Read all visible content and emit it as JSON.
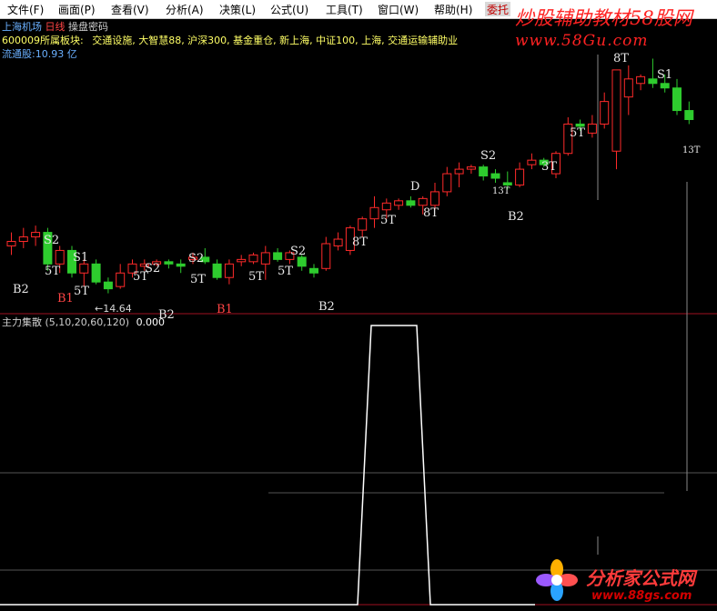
{
  "menu": [
    "文件(F)",
    "画面(P)",
    "查看(V)",
    "分析(A)",
    "决策(L)",
    "公式(U)",
    "工具(T)",
    "窗口(W)",
    "帮助(H)"
  ],
  "menu_trade": "委托",
  "watermark": {
    "top": "炒股辅助教材58股网",
    "url": "www.58Gu.com"
  },
  "header": {
    "stock_name": "上海机场",
    "period": "日线",
    "extra": "操盘密码",
    "sector_code_label": "600009所属板块:",
    "sectors": "交通设施, 大智慧88, 沪深300, 基金重仓, 新上海, 中证100, 上海, 交通运输辅助业",
    "float_shares": "流通股:10.93 亿"
  },
  "indicator": {
    "name": "主力集散",
    "params": "(5,10,20,60,120)",
    "value": "0.000"
  },
  "price_annotation": "←14.64",
  "signals": [
    {
      "text": "S2",
      "cls": "w"
    },
    {
      "text": "S1",
      "cls": "w"
    },
    {
      "text": "B2",
      "cls": "w"
    },
    {
      "text": "B1",
      "cls": "r"
    },
    {
      "text": "5T",
      "cls": "w"
    },
    {
      "text": "5T",
      "cls": "w"
    },
    {
      "text": "S2",
      "cls": "w"
    },
    {
      "text": "5T",
      "cls": "w"
    },
    {
      "text": "B2",
      "cls": "w"
    },
    {
      "text": "S2",
      "cls": "w"
    },
    {
      "text": "5T",
      "cls": "w"
    },
    {
      "text": "B1",
      "cls": "r"
    },
    {
      "text": "5T",
      "cls": "w"
    },
    {
      "text": "S2",
      "cls": "w"
    },
    {
      "text": "5T",
      "cls": "w"
    },
    {
      "text": "B2",
      "cls": "w"
    },
    {
      "text": "8T",
      "cls": "w"
    },
    {
      "text": "5T",
      "cls": "w"
    },
    {
      "text": "D",
      "cls": "w"
    },
    {
      "text": "8T",
      "cls": "w"
    },
    {
      "text": "S2",
      "cls": "w"
    },
    {
      "text": "13T",
      "cls": "w"
    },
    {
      "text": "B2",
      "cls": "w"
    },
    {
      "text": "3T",
      "cls": "w"
    },
    {
      "text": "5T",
      "cls": "w"
    },
    {
      "text": "8T",
      "cls": "w"
    },
    {
      "text": "S1",
      "cls": "w"
    },
    {
      "text": "13T",
      "cls": "w"
    }
  ],
  "logo": {
    "name": "分析家公式网",
    "url": "www.88gs.com"
  },
  "colors": {
    "up": "#ff2a2a",
    "down": "#2ecc2e",
    "divider": "#a01020",
    "text_yellow": "#ffff66",
    "text_blue": "#6ab0ff"
  },
  "chart_data": {
    "type": "candlestick",
    "series": [
      {
        "o": 13.9,
        "h": 14.2,
        "l": 13.7,
        "c": 14.0
      },
      {
        "o": 14.0,
        "h": 14.3,
        "l": 13.85,
        "c": 14.1
      },
      {
        "o": 14.1,
        "h": 14.35,
        "l": 13.9,
        "c": 14.2
      },
      {
        "o": 14.2,
        "h": 14.3,
        "l": 13.35,
        "c": 13.5
      },
      {
        "o": 13.5,
        "h": 13.9,
        "l": 13.3,
        "c": 13.8
      },
      {
        "o": 13.8,
        "h": 13.9,
        "l": 13.2,
        "c": 13.3
      },
      {
        "o": 13.3,
        "h": 13.6,
        "l": 13.0,
        "c": 13.5
      },
      {
        "o": 13.5,
        "h": 13.6,
        "l": 13.05,
        "c": 13.1
      },
      {
        "o": 13.1,
        "h": 13.2,
        "l": 12.85,
        "c": 12.95
      },
      {
        "o": 13.0,
        "h": 13.5,
        "l": 12.95,
        "c": 13.3
      },
      {
        "o": 13.3,
        "h": 13.6,
        "l": 13.2,
        "c": 13.5
      },
      {
        "o": 13.45,
        "h": 13.6,
        "l": 13.35,
        "c": 13.5
      },
      {
        "o": 13.5,
        "h": 13.6,
        "l": 13.45,
        "c": 13.55
      },
      {
        "o": 13.55,
        "h": 13.6,
        "l": 13.4,
        "c": 13.5
      },
      {
        "o": 13.5,
        "h": 13.6,
        "l": 13.3,
        "c": 13.45
      },
      {
        "o": 13.6,
        "h": 13.75,
        "l": 13.5,
        "c": 13.65
      },
      {
        "o": 13.65,
        "h": 13.85,
        "l": 13.5,
        "c": 13.55
      },
      {
        "o": 13.5,
        "h": 13.6,
        "l": 13.15,
        "c": 13.2
      },
      {
        "o": 13.2,
        "h": 13.6,
        "l": 13.05,
        "c": 13.5
      },
      {
        "o": 13.55,
        "h": 13.7,
        "l": 13.45,
        "c": 13.6
      },
      {
        "o": 13.55,
        "h": 13.75,
        "l": 13.5,
        "c": 13.7
      },
      {
        "o": 13.5,
        "h": 13.9,
        "l": 13.15,
        "c": 13.75
      },
      {
        "o": 13.75,
        "h": 13.85,
        "l": 13.55,
        "c": 13.6
      },
      {
        "o": 13.6,
        "h": 13.8,
        "l": 13.5,
        "c": 13.75
      },
      {
        "o": 13.65,
        "h": 13.7,
        "l": 13.35,
        "c": 13.45
      },
      {
        "o": 13.4,
        "h": 13.5,
        "l": 13.2,
        "c": 13.3
      },
      {
        "o": 13.4,
        "h": 14.1,
        "l": 13.35,
        "c": 13.95
      },
      {
        "o": 13.9,
        "h": 14.2,
        "l": 13.8,
        "c": 14.05
      },
      {
        "o": 13.8,
        "h": 14.35,
        "l": 13.7,
        "c": 14.3
      },
      {
        "o": 14.25,
        "h": 14.55,
        "l": 14.1,
        "c": 14.5
      },
      {
        "o": 14.5,
        "h": 15.0,
        "l": 14.3,
        "c": 14.75
      },
      {
        "o": 14.7,
        "h": 14.95,
        "l": 14.5,
        "c": 14.85
      },
      {
        "o": 14.8,
        "h": 14.95,
        "l": 14.7,
        "c": 14.9
      },
      {
        "o": 14.9,
        "h": 15.0,
        "l": 14.75,
        "c": 14.8
      },
      {
        "o": 14.8,
        "h": 15.0,
        "l": 14.6,
        "c": 14.95
      },
      {
        "o": 14.8,
        "h": 15.3,
        "l": 14.7,
        "c": 15.1
      },
      {
        "o": 15.1,
        "h": 15.65,
        "l": 15.0,
        "c": 15.5
      },
      {
        "o": 15.5,
        "h": 15.75,
        "l": 15.2,
        "c": 15.6
      },
      {
        "o": 15.6,
        "h": 15.7,
        "l": 15.5,
        "c": 15.65
      },
      {
        "o": 15.65,
        "h": 15.7,
        "l": 15.35,
        "c": 15.45
      },
      {
        "o": 15.5,
        "h": 15.6,
        "l": 15.3,
        "c": 15.4
      },
      {
        "o": 15.3,
        "h": 15.55,
        "l": 15.15,
        "c": 15.25
      },
      {
        "o": 15.25,
        "h": 15.75,
        "l": 15.2,
        "c": 15.6
      },
      {
        "o": 15.7,
        "h": 15.95,
        "l": 15.6,
        "c": 15.8
      },
      {
        "o": 15.8,
        "h": 15.85,
        "l": 15.65,
        "c": 15.7
      },
      {
        "o": 15.5,
        "h": 16.0,
        "l": 15.4,
        "c": 15.95
      },
      {
        "o": 15.95,
        "h": 16.75,
        "l": 15.9,
        "c": 16.6
      },
      {
        "o": 16.6,
        "h": 16.7,
        "l": 16.45,
        "c": 16.55
      },
      {
        "o": 16.4,
        "h": 16.8,
        "l": 16.3,
        "c": 16.6
      },
      {
        "o": 16.6,
        "h": 17.3,
        "l": 16.5,
        "c": 17.1
      },
      {
        "o": 16.0,
        "h": 17.4,
        "l": 15.6,
        "c": 17.8
      },
      {
        "o": 17.2,
        "h": 17.9,
        "l": 16.8,
        "c": 17.6
      },
      {
        "o": 17.5,
        "h": 17.7,
        "l": 17.35,
        "c": 17.65
      },
      {
        "o": 17.6,
        "h": 18.05,
        "l": 17.4,
        "c": 17.5
      },
      {
        "o": 17.5,
        "h": 17.7,
        "l": 17.3,
        "c": 17.4
      },
      {
        "o": 17.4,
        "h": 17.6,
        "l": 16.8,
        "c": 16.9
      },
      {
        "o": 16.9,
        "h": 17.1,
        "l": 16.6,
        "c": 16.7
      }
    ],
    "y_label_value": 14.64,
    "indicator_series": [
      0,
      0,
      0,
      0,
      0,
      0,
      0,
      0,
      0,
      0,
      0,
      0,
      0,
      0,
      0,
      0,
      0,
      0,
      0,
      0,
      0,
      0,
      0,
      0,
      0,
      0,
      0,
      0,
      0,
      1,
      1,
      1,
      1,
      1,
      0,
      0,
      0,
      0,
      0,
      0,
      0,
      0,
      0,
      0,
      0,
      0,
      0,
      0,
      0,
      0,
      0,
      0,
      0,
      0,
      0,
      0,
      0
    ]
  }
}
